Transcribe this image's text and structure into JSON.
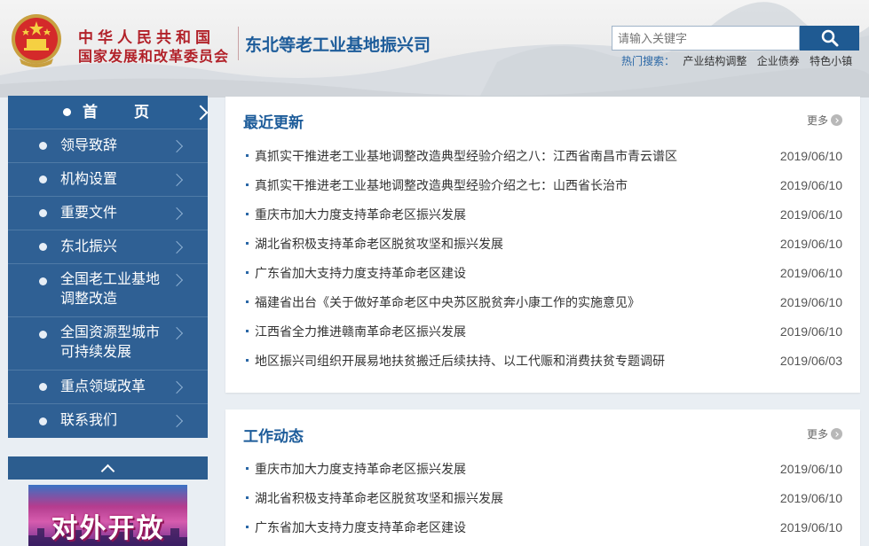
{
  "header": {
    "org_line1": "中华人民共和国",
    "org_line2": "国家发展和改革委员会",
    "dept_title": "东北等老工业基地振兴司",
    "search_placeholder": "请输入关键字",
    "search_icon": "search-icon",
    "hot_label": "热门搜索：",
    "hot_items": [
      "产业结构调整",
      "企业债券",
      "特色小镇"
    ]
  },
  "sidebar": {
    "items": [
      {
        "label": "首　页",
        "active": true
      },
      {
        "label": "领导致辞"
      },
      {
        "label": "机构设置"
      },
      {
        "label": "重要文件"
      },
      {
        "label": "东北振兴"
      },
      {
        "label_lines": [
          "全国老工业基地",
          "调整改造"
        ]
      },
      {
        "label_lines": [
          "全国资源型城市",
          "可持续发展"
        ]
      },
      {
        "label": "重点领域改革"
      },
      {
        "label": "联系我们"
      }
    ],
    "banner_text": "对外开放"
  },
  "recent": {
    "title": "最近更新",
    "more": "更多",
    "items": [
      {
        "title": "真抓实干推进老工业基地调整改造典型经验介绍之八：江西省南昌市青云谱区",
        "date": "2019/06/10"
      },
      {
        "title": "真抓实干推进老工业基地调整改造典型经验介绍之七：山西省长治市",
        "date": "2019/06/10"
      },
      {
        "title": "重庆市加大力度支持革命老区振兴发展",
        "date": "2019/06/10"
      },
      {
        "title": "湖北省积极支持革命老区脱贫攻坚和振兴发展",
        "date": "2019/06/10"
      },
      {
        "title": "广东省加大支持力度支持革命老区建设",
        "date": "2019/06/10"
      },
      {
        "title": "福建省出台《关于做好革命老区中央苏区脱贫奔小康工作的实施意见》",
        "date": "2019/06/10"
      },
      {
        "title": "江西省全力推进赣南革命老区振兴发展",
        "date": "2019/06/10"
      },
      {
        "title": "地区振兴司组织开展易地扶贫搬迁后续扶持、以工代赈和消费扶贫专题调研",
        "date": "2019/06/03"
      }
    ]
  },
  "work": {
    "title": "工作动态",
    "more": "更多",
    "items": [
      {
        "title": "重庆市加大力度支持革命老区振兴发展",
        "date": "2019/06/10"
      },
      {
        "title": "湖北省积极支持革命老区脱贫攻坚和振兴发展",
        "date": "2019/06/10"
      },
      {
        "title": "广东省加大支持力度支持革命老区建设",
        "date": "2019/06/10"
      }
    ]
  },
  "colors": {
    "brand_red": "#b2222a",
    "brand_blue": "#1d5c9a",
    "nav_bg": "#2f6094"
  }
}
